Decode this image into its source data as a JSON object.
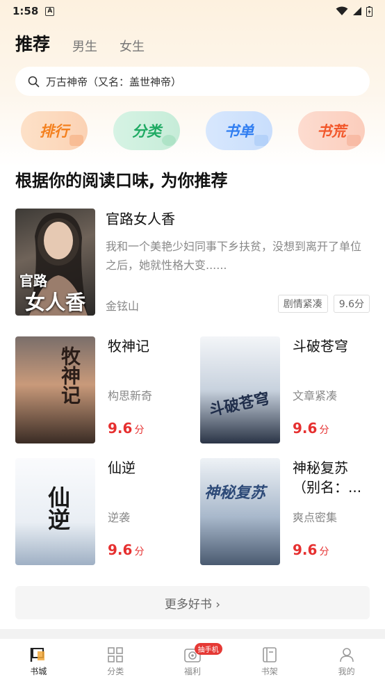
{
  "status_bar": {
    "time": "1:58",
    "notification_letter": "A"
  },
  "header": {
    "active_tab": "推荐",
    "tabs": [
      "男生",
      "女生"
    ]
  },
  "search": {
    "text": "万古神帝（又名：盖世神帝）"
  },
  "categories": [
    {
      "label": "排行",
      "color": "#f4801e"
    },
    {
      "label": "分类",
      "color": "#1faa63"
    },
    {
      "label": "书单",
      "color": "#2f7df1"
    },
    {
      "label": "书荒",
      "color": "#f2572a"
    }
  ],
  "section": {
    "title": "根据你的阅读口味, 为你推荐"
  },
  "featured": {
    "title": "官路女人香",
    "description": "我和一个美艳少妇同事下乡扶贫，没想到离开了单位之后，她就性格大变......",
    "author": "金铉山",
    "tags": [
      "剧情紧凑",
      "9.6分"
    ],
    "cover_text": [
      "官路",
      "女人香"
    ]
  },
  "books": [
    {
      "title": "牧神记",
      "tagline": "构思新奇",
      "score": "9.6",
      "unit": "分",
      "cover_text": "牧神记"
    },
    {
      "title": "斗破苍穹",
      "tagline": "文章紧凑",
      "score": "9.6",
      "unit": "分",
      "cover_text": "斗破苍穹"
    },
    {
      "title": "仙逆",
      "tagline": "逆袭",
      "score": "9.6",
      "unit": "分",
      "cover_text": "仙逆"
    },
    {
      "title": "神秘复苏（别名：...",
      "tagline": "爽点密集",
      "score": "9.6",
      "unit": "分",
      "cover_text": "神秘复苏"
    }
  ],
  "more_button": {
    "label": "更多好书 ›"
  },
  "bottom_nav": [
    {
      "label": "书城",
      "icon": "flag-icon",
      "active": true
    },
    {
      "label": "分类",
      "icon": "grid-icon"
    },
    {
      "label": "福利",
      "icon": "camera-icon",
      "badge": "抽手机"
    },
    {
      "label": "书架",
      "icon": "book-icon"
    },
    {
      "label": "我的",
      "icon": "person-icon"
    }
  ]
}
